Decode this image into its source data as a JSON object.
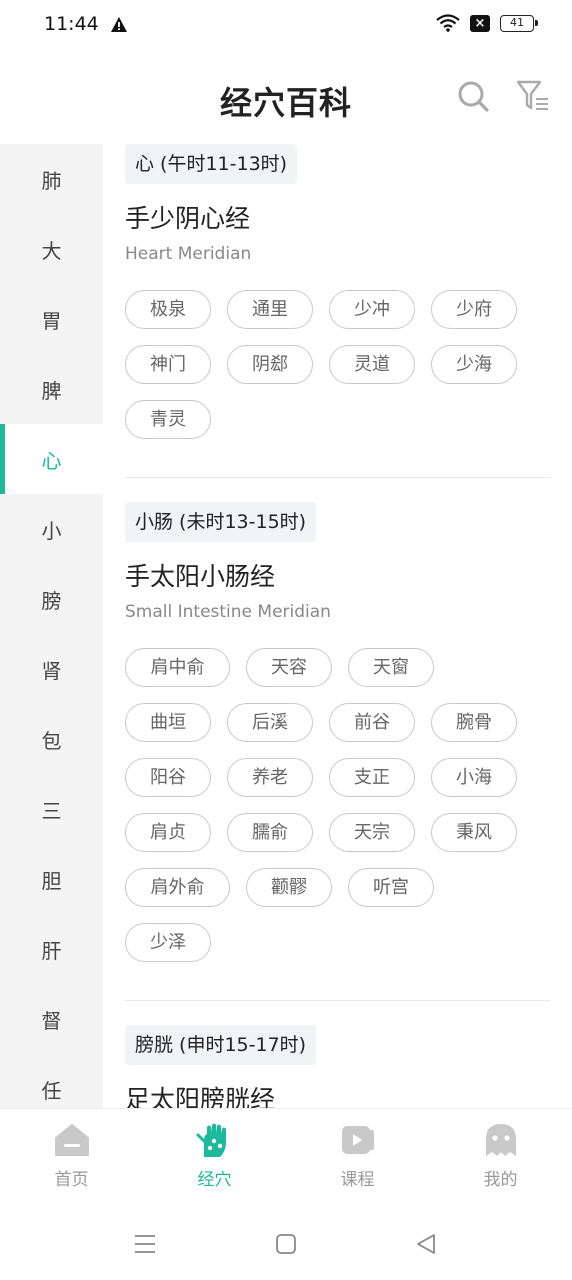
{
  "status_bar": {
    "time": "11:44",
    "battery": "41"
  },
  "header": {
    "title": "经穴百科"
  },
  "sidebar": {
    "items": [
      "肺",
      "大",
      "胃",
      "脾",
      "心",
      "小",
      "膀",
      "肾",
      "包",
      "三",
      "胆",
      "肝",
      "督",
      "任"
    ],
    "active_index": 4
  },
  "sections": [
    {
      "tag": "心 (午时11-13时)",
      "title": "手少阴心经",
      "subtitle": "Heart Meridian",
      "points": [
        "极泉",
        "通里",
        "少冲",
        "少府",
        "神门",
        "阴郄",
        "灵道",
        "少海",
        "青灵"
      ]
    },
    {
      "tag": "小肠 (未时13-15时)",
      "title": "手太阳小肠经",
      "subtitle": "Small Intestine Meridian",
      "points": [
        "肩中俞",
        "天容",
        "天窗",
        "曲垣",
        "后溪",
        "前谷",
        "腕骨",
        "阳谷",
        "养老",
        "支正",
        "小海",
        "肩贞",
        "臑俞",
        "天宗",
        "秉风",
        "肩外俞",
        "颧髎",
        "听宫",
        "少泽"
      ]
    },
    {
      "tag": "膀胱 (申时15-17时)",
      "title": "足太阳膀胱经",
      "subtitle": "",
      "points": []
    }
  ],
  "tabs": [
    {
      "label": "首页",
      "icon": "home-icon"
    },
    {
      "label": "经穴",
      "icon": "hand-acupoint-icon"
    },
    {
      "label": "课程",
      "icon": "play-course-icon"
    },
    {
      "label": "我的",
      "icon": "profile-ghost-icon"
    }
  ],
  "active_tab": 1,
  "colors": {
    "accent": "#1cb99a",
    "sidebar_bg": "#f4f4f4",
    "tag_bg": "#f2f3f5"
  }
}
